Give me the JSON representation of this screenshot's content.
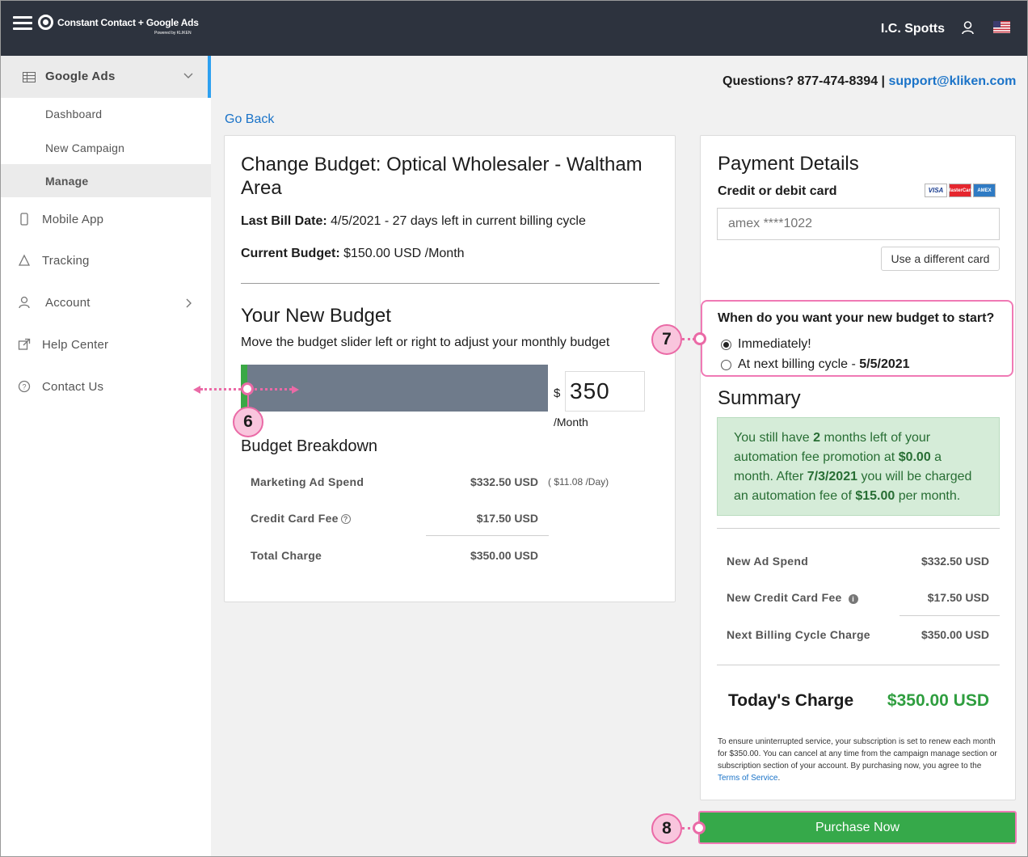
{
  "header": {
    "logo_text": "Constant Contact + Google Ads",
    "logo_sub": "Powered by KLIKEN",
    "user_name": "I.C. Spotts"
  },
  "sidebar": {
    "section_label": "Google Ads",
    "sub_items": [
      "Dashboard",
      "New Campaign",
      "Manage"
    ],
    "items": [
      {
        "label": "Mobile App",
        "icon": "phone-icon"
      },
      {
        "label": "Tracking",
        "icon": "tracking-icon"
      },
      {
        "label": "Account",
        "icon": "user-icon"
      },
      {
        "label": "Help Center",
        "icon": "external-link-icon"
      },
      {
        "label": "Contact Us",
        "icon": "question-circle-icon"
      }
    ]
  },
  "support": {
    "questions_prefix": "Questions? 877-474-8394",
    "separator": "|",
    "email": "support@kliken.com"
  },
  "go_back": "Go Back",
  "budget": {
    "title": "Change Budget: Optical Wholesaler - Waltham Area",
    "last_bill_label": "Last Bill Date:",
    "last_bill_value": "4/5/2021 - 27 days left in current billing cycle",
    "current_budget_label": "Current Budget:",
    "current_budget_value": "$150.00 USD /Month",
    "new_budget_title": "Your New Budget",
    "slider_help": "Move the budget slider left or right to adjust your monthly budget",
    "slider_fraction": 0.02,
    "currency_symbol": "$",
    "amount": "350",
    "per_month": "/Month",
    "breakdown_title": "Budget Breakdown",
    "breakdown": [
      {
        "label": "Marketing Ad Spend",
        "value": "$332.50 USD",
        "note": "( $11.08 /Day)"
      },
      {
        "label": "Credit Card Fee",
        "value": "$17.50 USD"
      },
      {
        "label": "Total Charge",
        "value": "$350.00 USD"
      }
    ]
  },
  "payment": {
    "title": "Payment Details",
    "card_label": "Credit or debit card",
    "card_brands": [
      "VISA",
      "MasterCard",
      "AMEX"
    ],
    "card_placeholder": "amex ****1022",
    "different_card_button": "Use a different card",
    "start_question": "When do you want your new budget to start?",
    "option_immediately": "Immediately!",
    "option_next_cycle": "At next billing cycle - ",
    "option_next_cycle_date": "5/5/2021",
    "summary_title": "Summary",
    "promo": {
      "p1": "You still have ",
      "months": "2",
      "p2": " months left of your automation fee promotion at ",
      "fee_promo": "$0.00",
      "p3": " a month. After ",
      "date": "7/3/2021",
      "p4": " you will be charged an automation fee of ",
      "fee": "$15.00",
      "p5": " per month."
    },
    "summary_rows": [
      {
        "label": "New Ad Spend",
        "value": "$332.50 USD"
      },
      {
        "label": "New Credit Card Fee",
        "value": "$17.50 USD"
      },
      {
        "label": "Next Billing Cycle Charge",
        "value": "$350.00 USD"
      }
    ],
    "today_label": "Today's Charge",
    "today_value": "$350.00 USD",
    "fine_print": "To ensure uninterrupted service, your subscription is set to renew each month for $350.00. You can cancel at any time from the campaign manage section or subscription section of your account. By purchasing now, you agree to the ",
    "terms_link": "Terms of Service",
    "fine_end": "."
  },
  "purchase_button": "Purchase Now",
  "callouts": {
    "six": "6",
    "seven": "7",
    "eight": "8"
  },
  "colors": {
    "topbar": "#2d333e",
    "accent_blue": "#1a73c8",
    "green": "#36a94a",
    "callout_pink": "#ea6aa6"
  }
}
